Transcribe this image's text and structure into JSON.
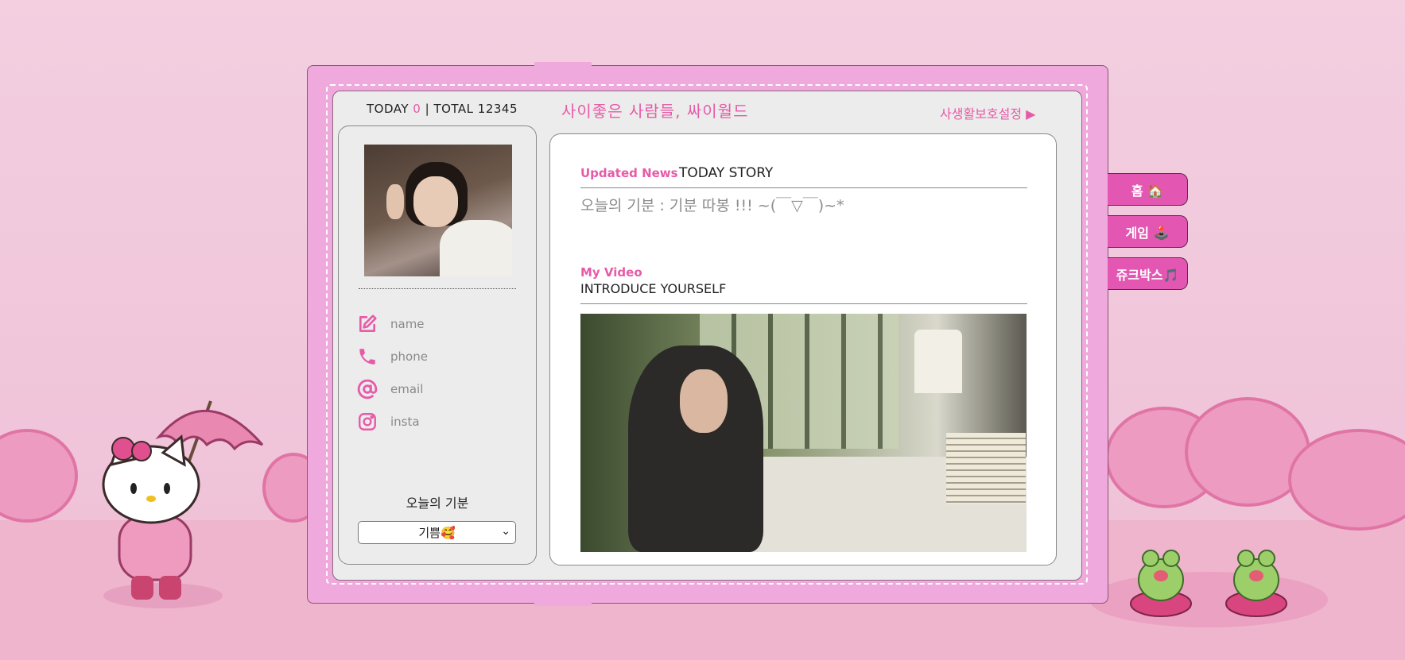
{
  "header": {
    "today_label": "TODAY",
    "today_value": "0",
    "total_label": "| TOTAL 12345",
    "site_title": "사이좋은 사람들, 싸이월드",
    "privacy_label": "사생활보호설정 ▶"
  },
  "profile": {
    "fields": [
      {
        "icon": "edit-icon",
        "label": "name"
      },
      {
        "icon": "phone-icon",
        "label": "phone"
      },
      {
        "icon": "at-icon",
        "label": "email"
      },
      {
        "icon": "instagram-icon",
        "label": "insta"
      }
    ],
    "mood_label": "오늘의 기분",
    "mood_selected": "기쁨🥰"
  },
  "main": {
    "news_label": "Updated News",
    "news_title": "TODAY STORY",
    "mood_text": "오늘의 기분 : 기분 따봉 !!! ~(￣▽￣)~*",
    "video_label": "My Video",
    "video_title": "INTRODUCE YOURSELF"
  },
  "tabs": [
    {
      "label": "홈 🏠"
    },
    {
      "label": "게임 🕹️"
    },
    {
      "label": "쥬크박스🎵"
    }
  ],
  "colors": {
    "accent": "#e75aa8",
    "book": "#f0a9dd",
    "tab": "#e357b3"
  }
}
